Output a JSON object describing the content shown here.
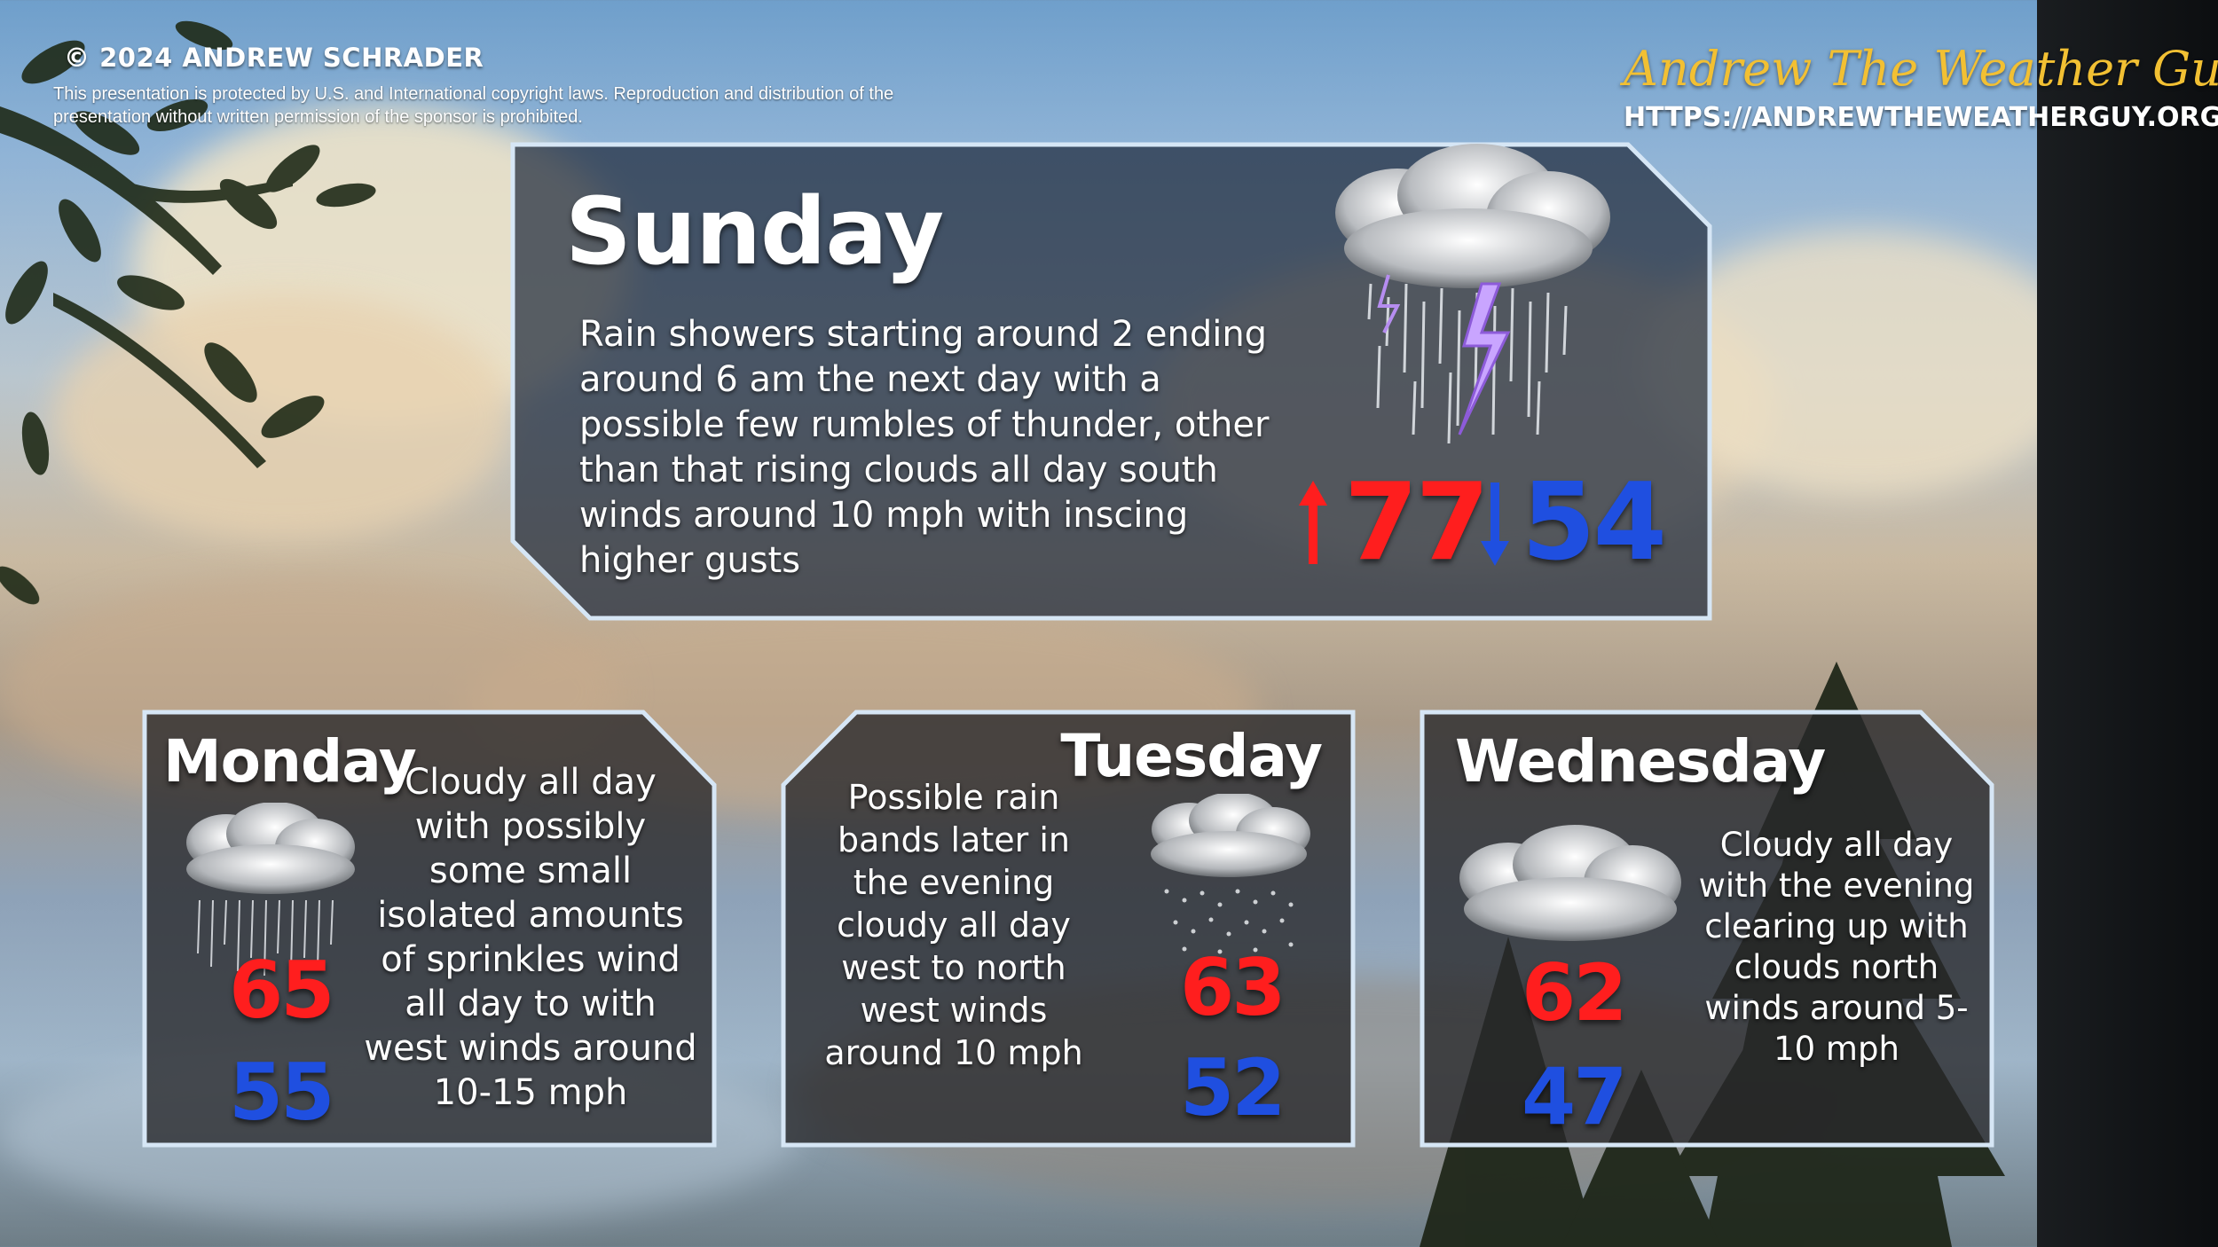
{
  "header": {
    "copyright": "© 2024 ANDREW SCHRADER",
    "legal": "This presentation is protected by U.S. and International copyright laws. Reproduction and distribution of the presentation without written permission of the sponsor is prohibited."
  },
  "brand": {
    "name": "Andrew The Weather Guy",
    "url": "HTTPS://ANDREWTHEWEATHERGUY.ORG"
  },
  "forecast": {
    "sunday": {
      "day": "Sunday",
      "description": "Rain showers starting around 2 ending around 6 am the next day with a possible few rumbles of thunder, other than that rising clouds all day south winds around 10 mph with inscing higher gusts",
      "high": "77",
      "low": "54",
      "icon": "thunderstorm-icon"
    },
    "monday": {
      "day": "Monday",
      "description": "Cloudy all day with possibly some small isolated amounts of sprinkles wind all day to with west winds around 10-15 mph",
      "high": "65",
      "low": "55",
      "icon": "rain-icon"
    },
    "tuesday": {
      "day": "Tuesday",
      "description": "Possible rain bands later in the evening cloudy all day west to north west winds around 10 mph",
      "high": "63",
      "low": "52",
      "icon": "drizzle-icon"
    },
    "wednesday": {
      "day": "Wednesday",
      "description": "Cloudy all day with the evening clearing up with clouds north winds around 5-10 mph",
      "high": "62",
      "low": "47",
      "icon": "cloud-icon"
    }
  },
  "colors": {
    "high": "#ff1e1e",
    "low": "#1f4fe0",
    "brand": "#f2c033",
    "panel_border": "#d6e6f5"
  }
}
